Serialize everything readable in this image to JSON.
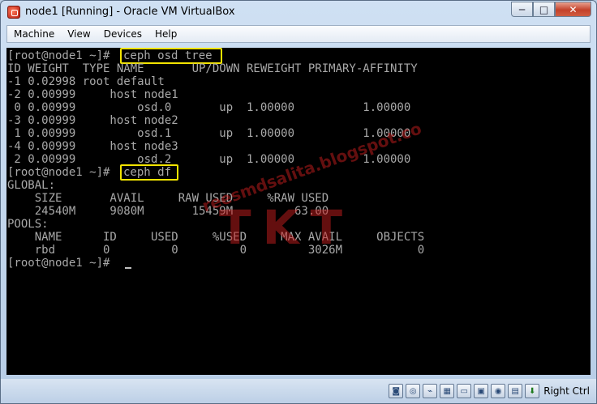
{
  "window": {
    "title": "node1 [Running] - Oracle VM VirtualBox",
    "buttons": {
      "minimize": "─",
      "maximize": "□",
      "close": "✕"
    }
  },
  "menubar": {
    "items": [
      "Machine",
      "View",
      "Devices",
      "Help"
    ]
  },
  "terminal": {
    "prompt1": "[root@node1 ~]# ",
    "command1": "ceph osd tree",
    "tree_lines": [
      "ID WEIGHT  TYPE NAME       UP/DOWN REWEIGHT PRIMARY-AFFINITY",
      "-1 0.02998 root default",
      "-2 0.00999     host node1",
      " 0 0.00999         osd.0       up  1.00000          1.00000",
      "-3 0.00999     host node2",
      " 1 0.00999         osd.1       up  1.00000          1.00000",
      "-4 0.00999     host node3",
      " 2 0.00999         osd.2       up  1.00000          1.00000"
    ],
    "prompt2": "[root@node1 ~]# ",
    "command2": "ceph df",
    "df_lines": [
      "GLOBAL:",
      "    SIZE       AVAIL     RAW USED     %RAW USED",
      "    24540M     9080M       15459M         63.00",
      "POOLS:",
      "    NAME      ID     USED     %USED     MAX AVAIL     OBJECTS",
      "    rbd       0         0         0         3026M           0"
    ],
    "prompt3": "[root@node1 ~]# "
  },
  "watermark": {
    "url": "reesmdsalita.blogspot.co",
    "mark": "TKT"
  },
  "statusbar": {
    "icons": [
      "hdd-icon",
      "optical-drive-icon",
      "usb-icon",
      "network-icon",
      "shared-folders-icon",
      "display-icon",
      "video-capture-icon",
      "virtualization-icon",
      "mouse-integration-icon"
    ],
    "host_key": "Right Ctrl"
  },
  "colors": {
    "terminal_bg": "#000000",
    "terminal_text": "#a8a8a8",
    "highlight": "#f3e400",
    "watermark": "#c81e1e"
  }
}
